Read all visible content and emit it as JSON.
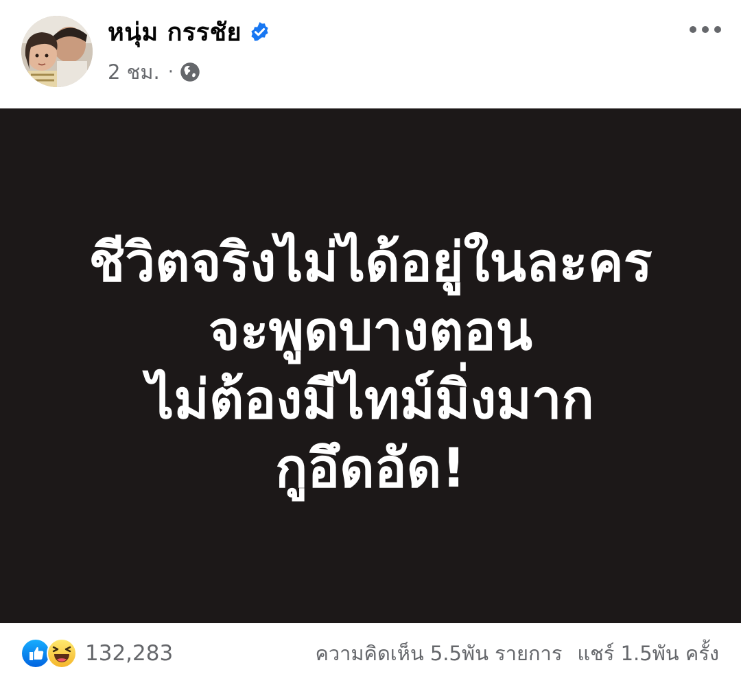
{
  "post": {
    "author_name": "หนุ่ม กรรชัย",
    "timestamp": "2 ชม.",
    "separator": "·",
    "privacy_icon": "globe-icon",
    "verified_icon": "verified-badge-icon",
    "more_icon": "more-options-icon",
    "image_text_lines": [
      "ชีวิตจริงไม่ได้อยู่ในละคร",
      "จะพูดบางตอน",
      "ไม่ต้องมีไทม์มิ่งมาก",
      "กูอึดอัด!"
    ],
    "image_background": "#1c1818"
  },
  "footer": {
    "reaction_icons": [
      "like-icon",
      "haha-icon"
    ],
    "reaction_count": "132,283",
    "comments": "ความคิดเห็น 5.5พัน รายการ",
    "shares": "แชร์ 1.5พัน ครั้ง"
  },
  "colors": {
    "accent": "#1877f2",
    "secondary_text": "#65676b",
    "primary_text": "#050505"
  }
}
